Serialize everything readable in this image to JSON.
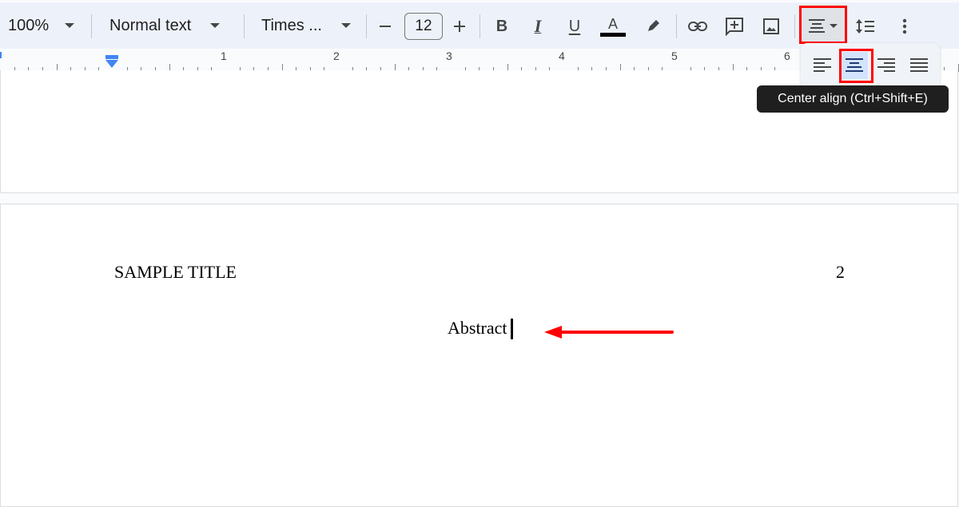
{
  "toolbar": {
    "zoom": "100%",
    "style": "Normal text",
    "font": "Times ...",
    "font_size": "12",
    "decrease_font_icon": "minus-icon",
    "increase_font_icon": "plus-icon",
    "bold_icon": "B",
    "italic_icon": "I",
    "underline_icon": "U",
    "text_color_icon": "A",
    "text_color": "#000000",
    "highlight_icon": "pen-icon",
    "link_icon": "link-icon",
    "comment_icon": "add-comment-icon",
    "image_icon": "image-icon",
    "align_icon": "align-center-icon",
    "line_spacing_icon": "line-spacing-icon",
    "more_icon": "more-vert-icon"
  },
  "ruler": {
    "numbers": [
      "1",
      "2",
      "3",
      "4",
      "5",
      "6"
    ]
  },
  "align_menu": {
    "options": [
      "Left align",
      "Center align",
      "Right align",
      "Justify"
    ],
    "selected": "Center align"
  },
  "tooltip": {
    "text": "Center align (Ctrl+Shift+E)"
  },
  "document": {
    "header_title": "SAMPLE TITLE",
    "page_number": "2",
    "body_text": "Abstract"
  },
  "annotation": {
    "highlight_color": "#ff0000",
    "arrow_color": "#ff0000"
  }
}
